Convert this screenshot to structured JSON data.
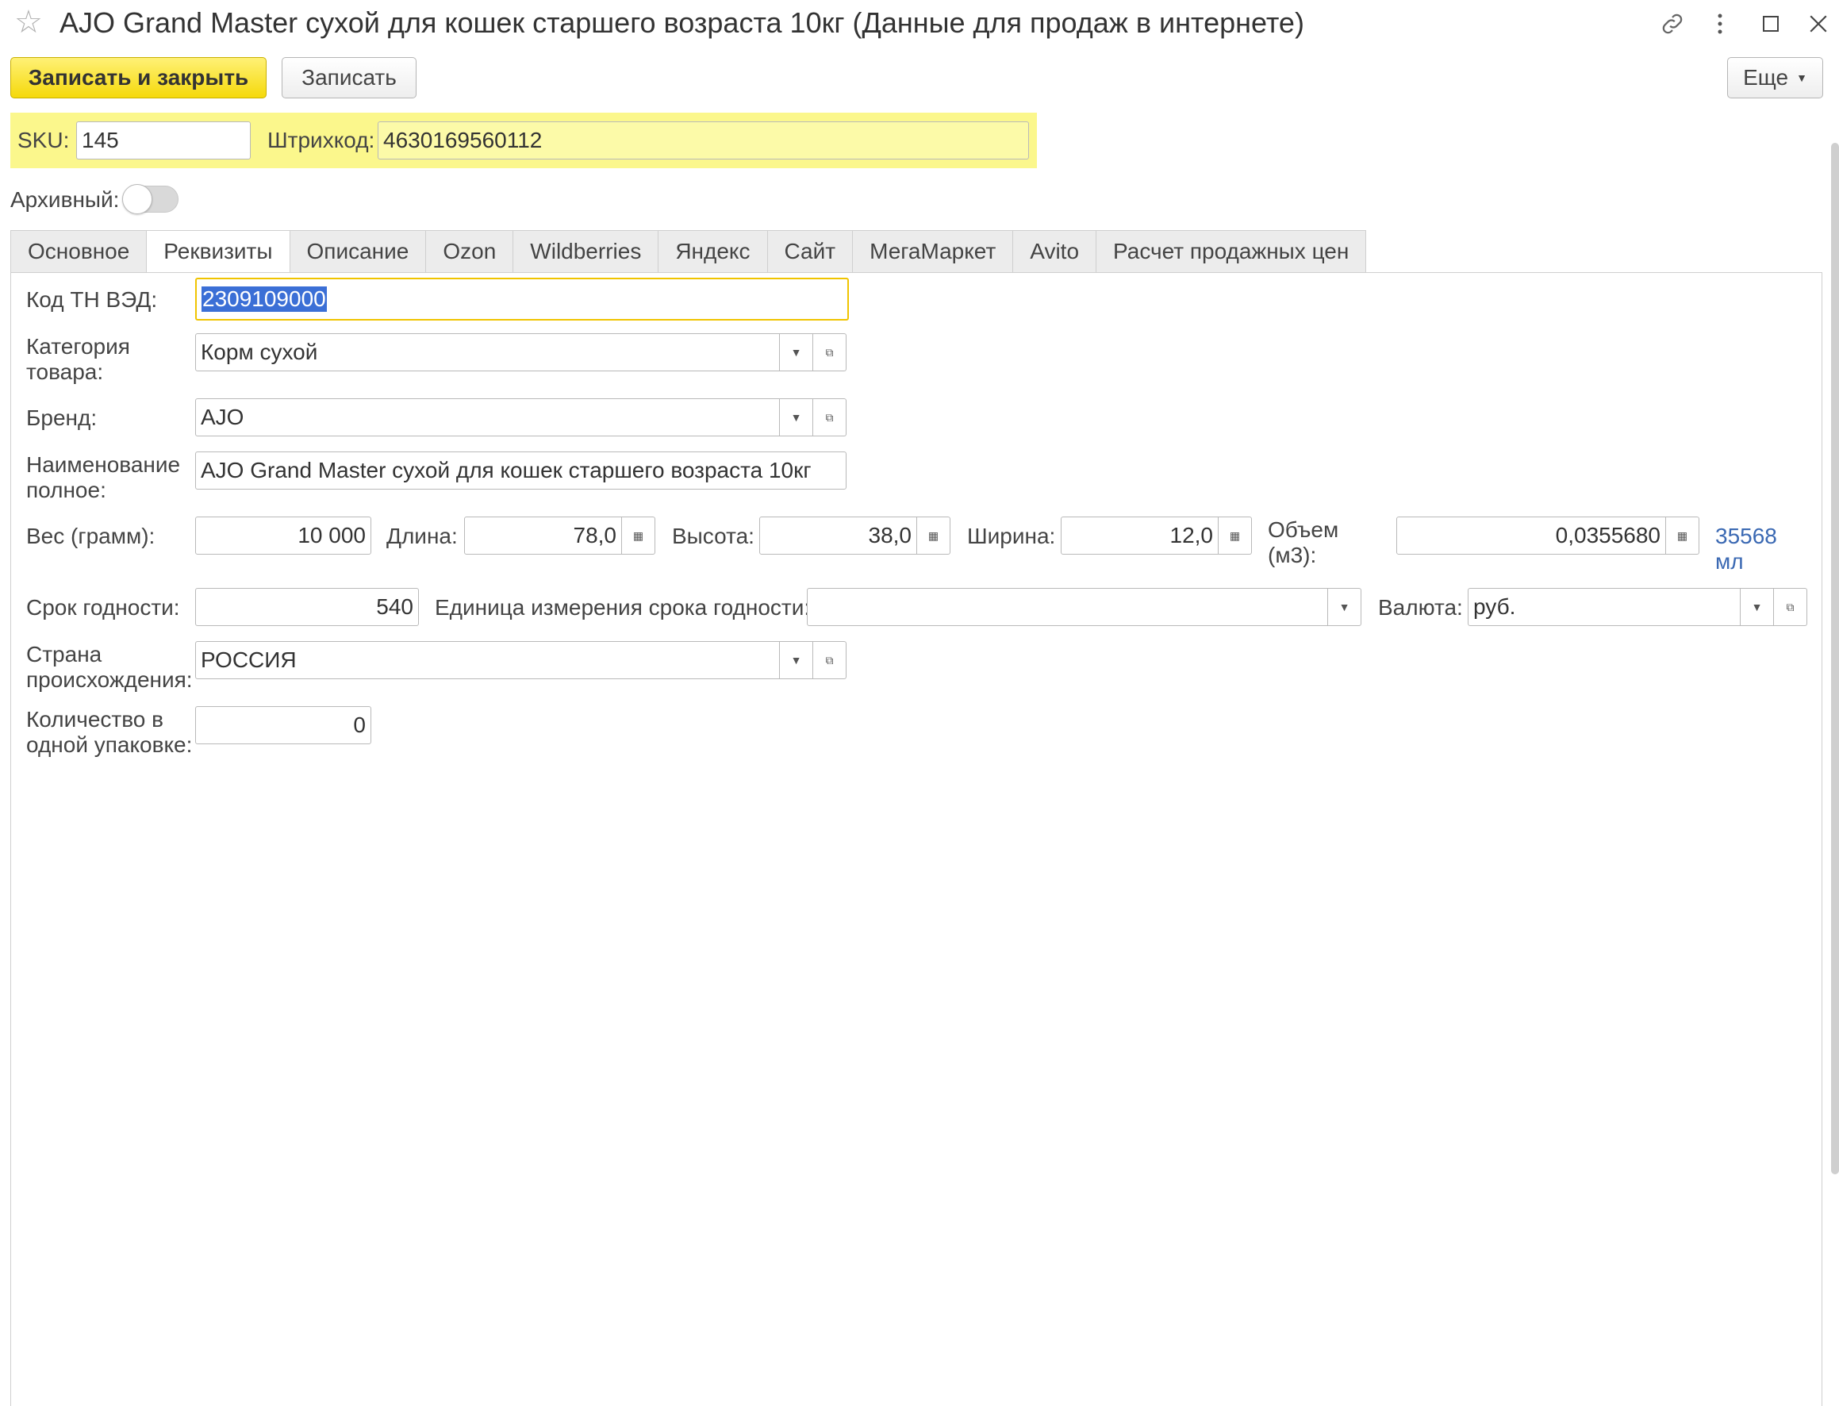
{
  "window": {
    "title": "AJO Grand Master сухой для кошек старшего возраста 10кг (Данные для продаж в интернете)"
  },
  "toolbar": {
    "save_close_label": "Записать и закрыть",
    "save_label": "Записать",
    "more_label": "Еще"
  },
  "header": {
    "sku_label": "SKU:",
    "sku_value": "145",
    "barcode_label": "Штрихкод:",
    "barcode_value": "4630169560112",
    "archived_label": "Архивный:",
    "archived": false
  },
  "tabs": [
    {
      "label": "Основное",
      "active": false
    },
    {
      "label": "Реквизиты",
      "active": true
    },
    {
      "label": "Описание",
      "active": false
    },
    {
      "label": "Ozon",
      "active": false
    },
    {
      "label": "Wildberries",
      "active": false
    },
    {
      "label": "Яндекс",
      "active": false
    },
    {
      "label": "Сайт",
      "active": false
    },
    {
      "label": "МегаМаркет",
      "active": false
    },
    {
      "label": "Avito",
      "active": false
    },
    {
      "label": "Расчет продажных цен",
      "active": false
    }
  ],
  "form": {
    "tnved": {
      "label": "Код ТН ВЭД:",
      "value": "2309109000"
    },
    "category": {
      "label_1": "Категория",
      "label_2": "товара:",
      "value": "Корм сухой"
    },
    "brand": {
      "label": "Бренд:",
      "value": "AJO"
    },
    "full_name": {
      "label_1": "Наименование",
      "label_2": "полное:",
      "value": "AJO Grand Master сухой для кошек старшего возраста 10кг"
    },
    "weight": {
      "label": "Вес (грамм):",
      "value": "10 000"
    },
    "length": {
      "label": "Длина:",
      "value": "78,0"
    },
    "height": {
      "label": "Высота:",
      "value": "38,0"
    },
    "width": {
      "label": "Ширина:",
      "value": "12,0"
    },
    "volume": {
      "label_1": "Объем",
      "label_2": "(м3):",
      "value": "0,0355680",
      "ml_value": "35568",
      "ml_unit": "мл"
    },
    "shelf_life": {
      "label": "Срок годности:",
      "value": "540"
    },
    "shelf_unit": {
      "label": "Единица измерения срока годности:",
      "value": ""
    },
    "currency": {
      "label": "Валюта:",
      "value": "руб."
    },
    "country": {
      "label_1": "Страна",
      "label_2": "происхождения:",
      "value": "РОССИЯ"
    },
    "pack_qty": {
      "label_1": "Количество в",
      "label_2": "одной упаковке:",
      "value": "0"
    }
  },
  "icons": {
    "favorite": "star-icon",
    "link": "link-icon",
    "menu": "more-vertical-icon",
    "maximize": "maximize-icon",
    "close": "close-icon",
    "dropdown": "chevron-down-icon",
    "open": "open-form-icon",
    "calculator": "calculator-icon"
  },
  "colors": {
    "primary_button": "#f5d90a",
    "highlight_bar": "#fbf78c",
    "selection": "#3b6fd6",
    "focus": "#f0c400",
    "link": "#3b69b3"
  }
}
